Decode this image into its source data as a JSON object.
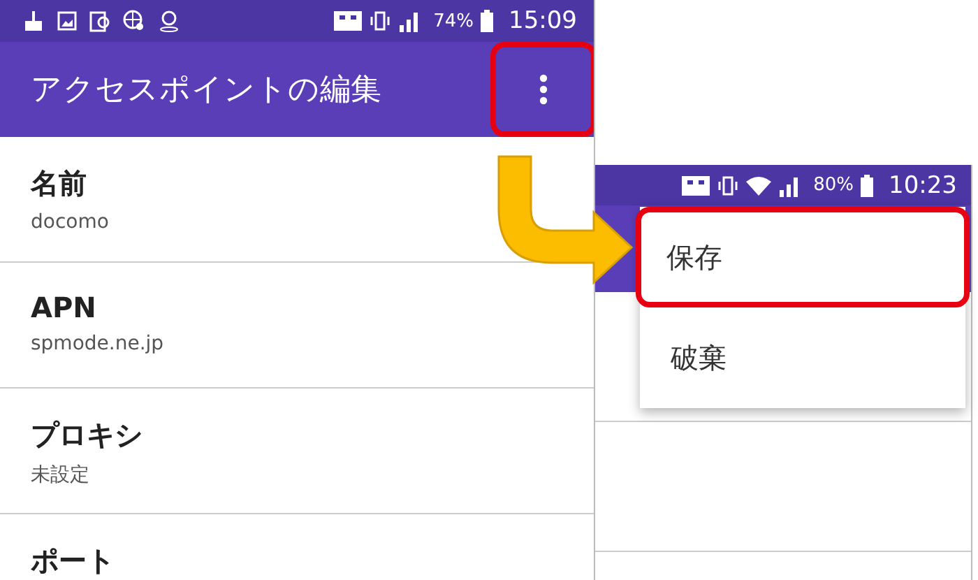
{
  "left_screen": {
    "status_bar": {
      "battery": "74%",
      "time": "15:09"
    },
    "toolbar": {
      "title": "アクセスポイントの編集",
      "overflow_highlighted": true
    },
    "settings": [
      {
        "label": "名前",
        "value": "docomo"
      },
      {
        "label": "APN",
        "value": "spmode.ne.jp"
      },
      {
        "label": "プロキシ",
        "value": "未設定"
      },
      {
        "label": "ポート"
      }
    ]
  },
  "right_screen": {
    "status_bar": {
      "battery": "80%",
      "time": "10:23"
    },
    "menu": [
      {
        "label": "保存",
        "highlighted": true
      },
      {
        "label": "破棄",
        "highlighted": false
      }
    ]
  }
}
